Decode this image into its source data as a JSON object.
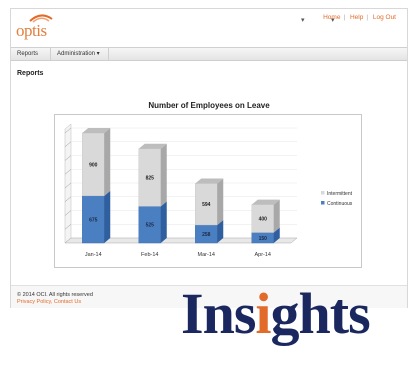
{
  "app": {
    "logo": "optis",
    "header_links": [
      "Home",
      "Help",
      "Log Out"
    ],
    "brand_color": "#e26b2a"
  },
  "nav": {
    "items": [
      "Reports",
      "Administration ▾"
    ]
  },
  "page": {
    "title": "Reports"
  },
  "chart_data": {
    "type": "bar",
    "stacked": true,
    "title": "Number of Employees on Leave",
    "categories": [
      "Jan-14",
      "Feb-14",
      "Mar-14",
      "Apr-14"
    ],
    "series": [
      {
        "name": "Continuous",
        "color": "#4a7fc1",
        "values": [
          675,
          525,
          258,
          150
        ]
      },
      {
        "name": "Intermittent",
        "color": "#d9d9d9",
        "values": [
          900,
          825,
          594,
          400
        ]
      }
    ],
    "legend_position": "right",
    "legend_labels": [
      "Intermittent",
      "Continuous"
    ],
    "grid": true,
    "style": "3d-columns"
  },
  "footer": {
    "copyright": "© 2014 OCI. All rights reserved",
    "links": "Privacy Policy, Contact Us"
  },
  "overlay": {
    "wordmark_parts": [
      "Ins",
      "i",
      "ghts"
    ],
    "accent_color": "#e26b2a",
    "text_color": "#1b2860"
  }
}
